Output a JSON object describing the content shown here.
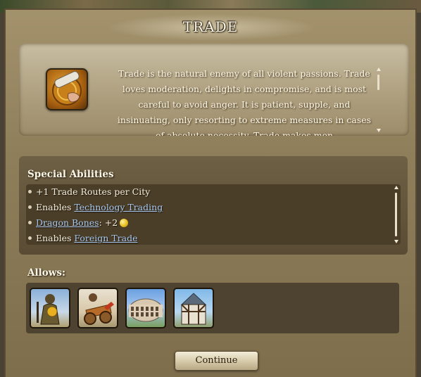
{
  "dialog": {
    "title": "TRADE",
    "intro_text": "Trade is the natural enemy of all violent passions. Trade loves moderation, delights in compromise, and is most careful to avoid anger. It is patient, supple, and insinuating, only resorting to extreme measures in cases of absolute necessity. Trade makes men",
    "icon": "trade-scroll-icon"
  },
  "abilities": {
    "heading": "Special Abilities",
    "items": [
      {
        "prefix": "+1 Trade Routes per City",
        "link": "",
        "suffix": ""
      },
      {
        "prefix": "Enables ",
        "link": "Technology Trading",
        "suffix": ""
      },
      {
        "prefix": "",
        "link": "Dragon Bones",
        "suffix": ": +2"
      },
      {
        "prefix": "Enables ",
        "link": "Foreign Trade",
        "suffix": ""
      }
    ]
  },
  "allows": {
    "heading": "Allows:",
    "items": [
      "armored-hero-unit-icon",
      "siege-cart-unit-icon",
      "colosseum-building-icon",
      "timber-house-building-icon"
    ]
  },
  "buttons": {
    "continue_label": "Continue"
  },
  "colors": {
    "frame": "#8e7e5a",
    "link": "#a8c8f0",
    "panel_dark": "#4a3e28"
  }
}
